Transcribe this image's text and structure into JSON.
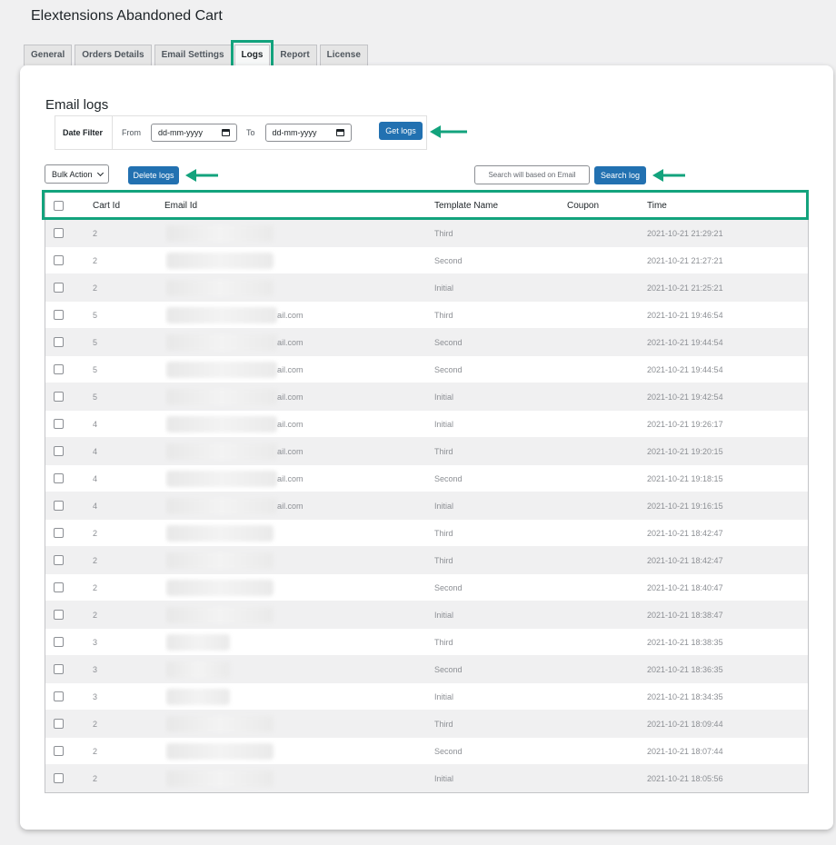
{
  "page_title": "Elextensions Abandoned Cart",
  "tabs": [
    {
      "label": "General"
    },
    {
      "label": "Orders Details"
    },
    {
      "label": "Email Settings"
    },
    {
      "label": "Logs",
      "active": true
    },
    {
      "label": "Report"
    },
    {
      "label": "License"
    }
  ],
  "section_title": "Email logs",
  "filter": {
    "label": "Date Filter",
    "from_label": "From",
    "from_value": "dd-mm-yyyy",
    "to_label": "To",
    "to_value": "dd-mm-yyyy",
    "get_logs_label": "Get logs"
  },
  "actions": {
    "bulk_action_label": "Bulk Action",
    "delete_logs_label": "Delete logs",
    "search_placeholder": "Search will based on Email",
    "search_log_label": "Search log"
  },
  "table": {
    "headers": {
      "cart_id": "Cart Id",
      "email_id": "Email Id",
      "template_name": "Template Name",
      "coupon": "Coupon",
      "time": "Time"
    },
    "rows": [
      {
        "cart_id": "2",
        "email_suffix": "",
        "template": "Third",
        "coupon": "",
        "time": "2021-10-21 21:29:21"
      },
      {
        "cart_id": "2",
        "email_suffix": "",
        "template": "Second",
        "coupon": "",
        "time": "2021-10-21 21:27:21"
      },
      {
        "cart_id": "2",
        "email_suffix": "",
        "template": "Initial",
        "coupon": "",
        "time": "2021-10-21 21:25:21"
      },
      {
        "cart_id": "5",
        "email_suffix": "ail.com",
        "template": "Third",
        "coupon": "",
        "time": "2021-10-21 19:46:54"
      },
      {
        "cart_id": "5",
        "email_suffix": "ail.com",
        "template": "Second",
        "coupon": "",
        "time": "2021-10-21 19:44:54"
      },
      {
        "cart_id": "5",
        "email_suffix": "ail.com",
        "template": "Second",
        "coupon": "",
        "time": "2021-10-21 19:44:54"
      },
      {
        "cart_id": "5",
        "email_suffix": "ail.com",
        "template": "Initial",
        "coupon": "",
        "time": "2021-10-21 19:42:54"
      },
      {
        "cart_id": "4",
        "email_suffix": "ail.com",
        "template": "Initial",
        "coupon": "",
        "time": "2021-10-21 19:26:17"
      },
      {
        "cart_id": "4",
        "email_suffix": "ail.com",
        "template": "Third",
        "coupon": "",
        "time": "2021-10-21 19:20:15"
      },
      {
        "cart_id": "4",
        "email_suffix": "ail.com",
        "template": "Second",
        "coupon": "",
        "time": "2021-10-21 19:18:15"
      },
      {
        "cart_id": "4",
        "email_suffix": "ail.com",
        "template": "Initial",
        "coupon": "",
        "time": "2021-10-21 19:16:15"
      },
      {
        "cart_id": "2",
        "email_suffix": "",
        "template": "Third",
        "coupon": "",
        "time": "2021-10-21 18:42:47"
      },
      {
        "cart_id": "2",
        "email_suffix": "",
        "template": "Third",
        "coupon": "",
        "time": "2021-10-21 18:42:47"
      },
      {
        "cart_id": "2",
        "email_suffix": "",
        "template": "Second",
        "coupon": "",
        "time": "2021-10-21 18:40:47"
      },
      {
        "cart_id": "2",
        "email_suffix": "",
        "template": "Initial",
        "coupon": "",
        "time": "2021-10-21 18:38:47"
      },
      {
        "cart_id": "3",
        "email_suffix": "",
        "template": "Third",
        "coupon": "",
        "time": "2021-10-21 18:38:35"
      },
      {
        "cart_id": "3",
        "email_suffix": "",
        "template": "Second",
        "coupon": "",
        "time": "2021-10-21 18:36:35"
      },
      {
        "cart_id": "3",
        "email_suffix": "",
        "template": "Initial",
        "coupon": "",
        "time": "2021-10-21 18:34:35"
      },
      {
        "cart_id": "2",
        "email_suffix": "",
        "template": "Third",
        "coupon": "",
        "time": "2021-10-21 18:09:44"
      },
      {
        "cart_id": "2",
        "email_suffix": "",
        "template": "Second",
        "coupon": "",
        "time": "2021-10-21 18:07:44"
      },
      {
        "cart_id": "2",
        "email_suffix": "",
        "template": "Initial",
        "coupon": "",
        "time": "2021-10-21 18:05:56"
      }
    ]
  },
  "colors": {
    "highlight": "#13a37d",
    "primary_button": "#2271b1",
    "stripe": "#f0f0f1"
  }
}
